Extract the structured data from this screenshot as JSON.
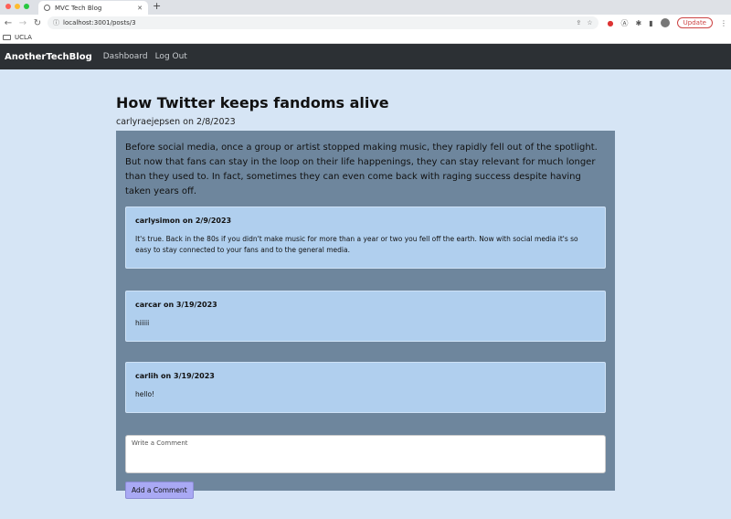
{
  "browser": {
    "tab_title": "MVC Tech Blog",
    "url": "localhost:3001/posts/3",
    "bookmark": "UCLA",
    "update_label": "Update"
  },
  "nav": {
    "brand": "AnotherTechBlog",
    "links": [
      "Dashboard",
      "Log Out"
    ]
  },
  "post": {
    "title": "How Twitter keeps fandoms alive",
    "meta": "carlyraejepsen on 2/8/2023",
    "body": "Before social media, once a group or artist stopped making music, they rapidly fell out of the spotlight. But now that fans can stay in the loop on their life happenings, they can stay relevant for much longer than they used to. In fact, sometimes they can even come back with raging success despite having taken years off."
  },
  "comments": [
    {
      "head": "carlysimon on 2/9/2023",
      "text": "It's true. Back in the 80s if you didn't make music for more than a year or two you fell off the earth. Now with social media it's so easy to stay connected to your fans and to the general media."
    },
    {
      "head": "carcar on 3/19/2023",
      "text": "hiiiii"
    },
    {
      "head": "carlih on 3/19/2023",
      "text": "hello!"
    }
  ],
  "form": {
    "placeholder": "Write a Comment",
    "submit_label": "Add a Comment"
  },
  "colors": {
    "page_bg": "#d6e5f5",
    "nav_bg": "#2c3034",
    "panel_bg": "#6e869d",
    "comment_bg": "#b0cfee",
    "button_bg": "#a9a9f4"
  }
}
